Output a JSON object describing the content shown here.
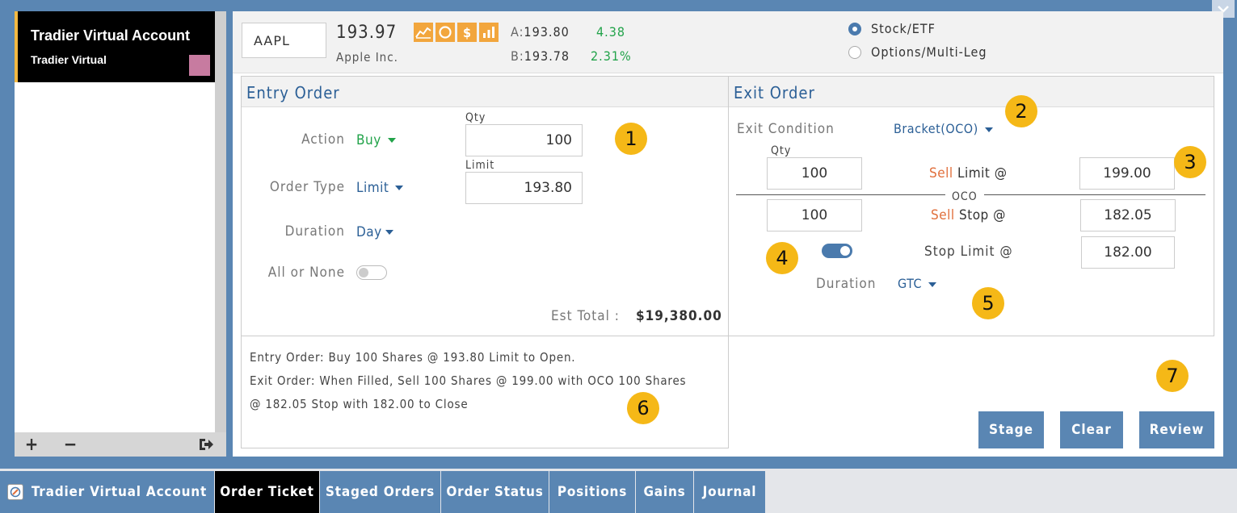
{
  "account_panel": {
    "account_name": "Tradier Virtual Account",
    "account_sub": "Tradier Virtual",
    "swatch_color": "#c77ba0",
    "add_icon": "+",
    "remove_icon": "−",
    "logout_icon": "➡"
  },
  "quote": {
    "symbol": "AAPL",
    "price": "193.97",
    "company": "Apple Inc.",
    "ask_label": "A:",
    "ask": "193.80",
    "bid_label": "B:",
    "bid": "193.78",
    "change": "4.38",
    "change_pct": "2.31%",
    "tool_icons": [
      "chart-icon",
      "circle-icon",
      "dollar-icon",
      "bar-chart-icon"
    ],
    "mode_stock": "Stock/ETF",
    "mode_options": "Options/Multi-Leg"
  },
  "entry": {
    "title": "Entry Order",
    "action_label": "Action",
    "action_value": "Buy",
    "order_type_label": "Order Type",
    "order_type_value": "Limit",
    "duration_label": "Duration",
    "duration_value": "Day",
    "all_or_none_label": "All or None",
    "qty_label": "Qty",
    "qty_value": "100",
    "limit_label": "Limit",
    "limit_value": "193.80",
    "est_total_label": "Est Total :",
    "est_total_value": "$19,380.00"
  },
  "exit": {
    "title": "Exit Order",
    "condition_label": "Exit Condition",
    "condition_value": "Bracket(OCO)",
    "qty_label": "Qty",
    "qty1": "100",
    "sell_word": "Sell",
    "limit_at": "Limit @",
    "limit_price": "199.00",
    "oco_label": "OCO",
    "qty2": "100",
    "stop_at": "Stop @",
    "stop_price": "182.05",
    "stop_limit_label": "Stop Limit @",
    "stop_limit_price": "182.00",
    "duration_label": "Duration",
    "duration_value": "GTC"
  },
  "summary": {
    "line1": "Entry Order:  Buy  100 Shares @ 193.80 Limit to Open.",
    "line2": "Exit Order: When Filled, Sell 100 Shares @ 199.00 with OCO 100 Shares",
    "line3": "@ 182.05 Stop with 182.00 to Close"
  },
  "buttons": {
    "stage": "Stage",
    "clear": "Clear",
    "review": "Review"
  },
  "badges": [
    "1",
    "2",
    "3",
    "4",
    "5",
    "6",
    "7"
  ],
  "tabs": {
    "account": "Tradier Virtual Account",
    "order_ticket": "Order Ticket",
    "staged_orders": "Staged Orders",
    "order_status": "Order Status",
    "positions": "Positions",
    "gains": "Gains",
    "journal": "Journal"
  },
  "colors": {
    "frame_blue": "#5a86b3",
    "heading_blue": "#2b5f96",
    "positive_green": "#22a34a",
    "sell_orange": "#e06f3c",
    "badge_yellow": "#f5b817",
    "icon_orange": "#f2a63d"
  }
}
